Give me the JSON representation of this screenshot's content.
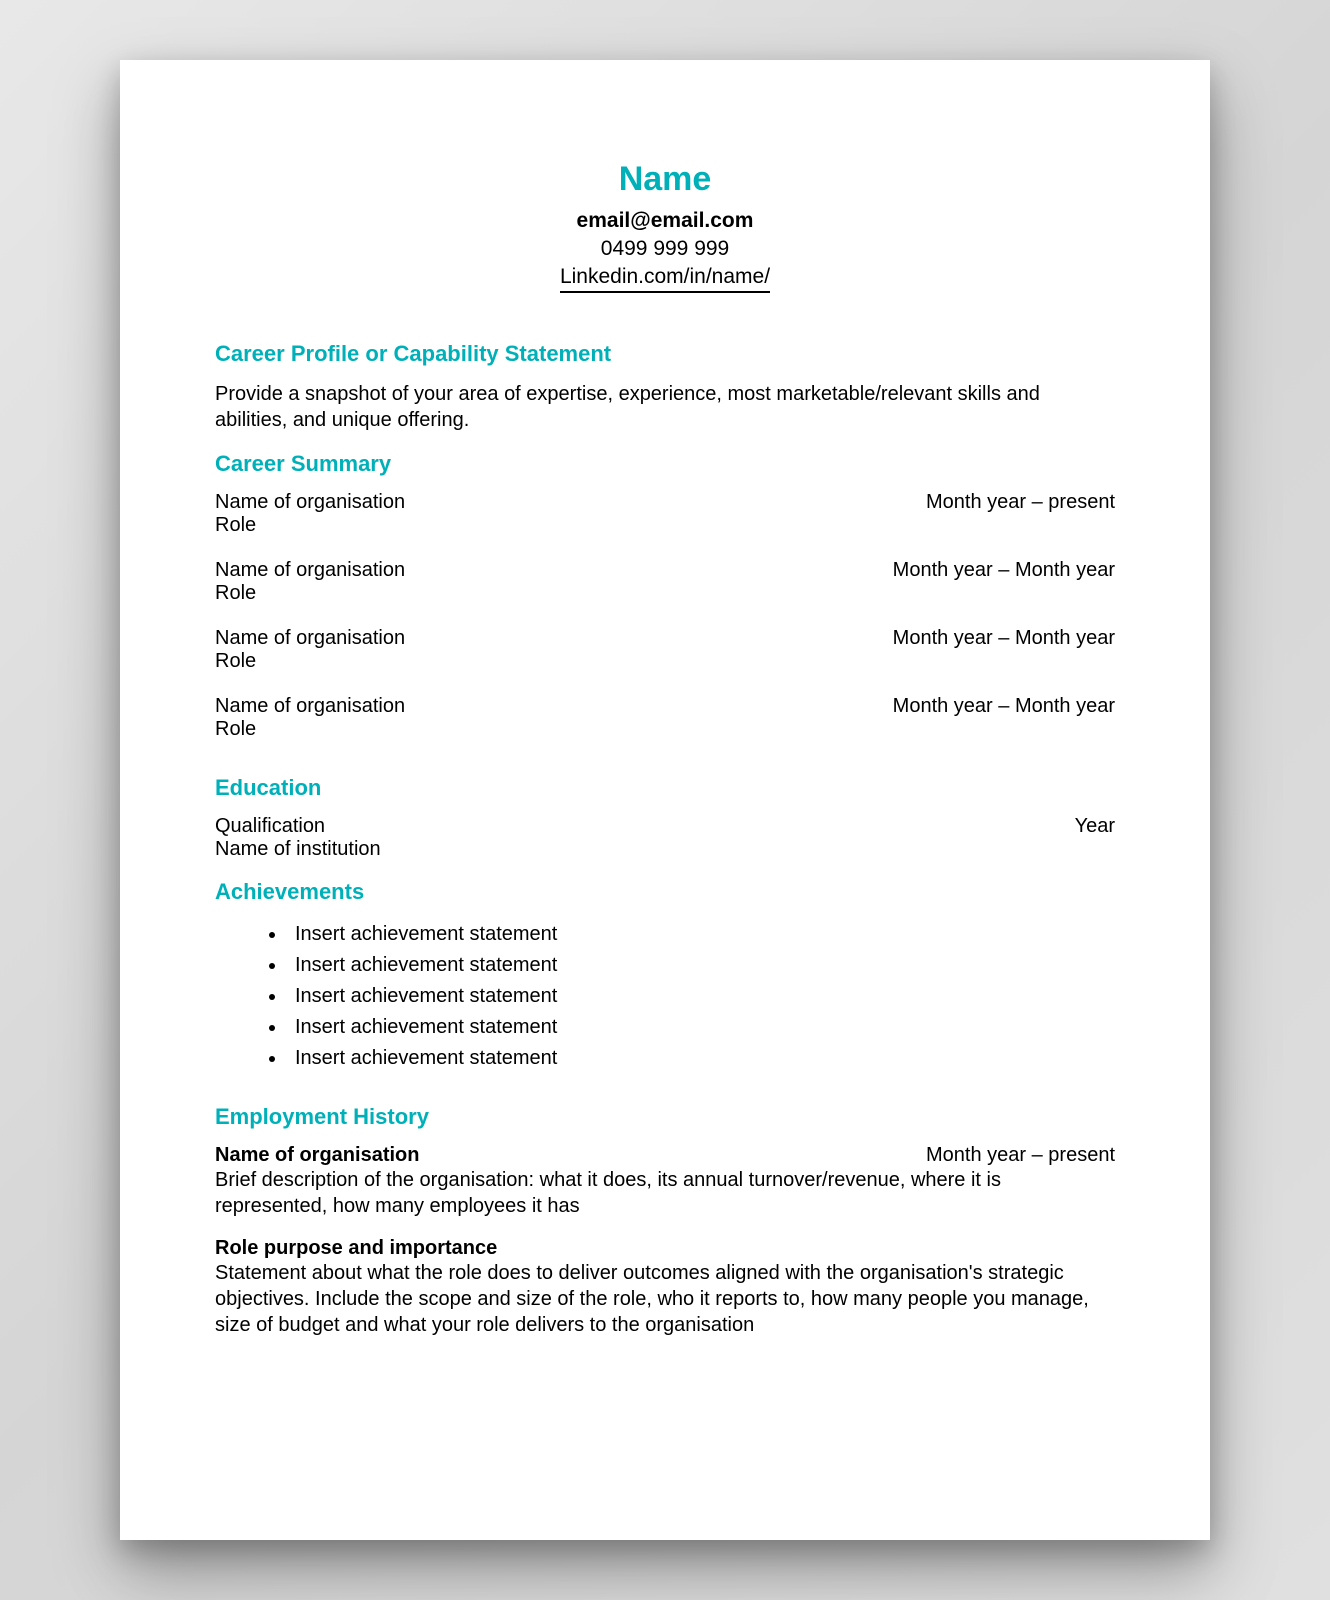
{
  "colors": {
    "accent": "#00b0b9"
  },
  "header": {
    "name": "Name",
    "email": "email@email.com",
    "phone": "0499 999 999",
    "linkedin": "Linkedin.com/in/name/"
  },
  "sections": {
    "career_profile": {
      "title": "Career Profile or Capability Statement",
      "body": "Provide a snapshot of your area of expertise, experience, most marketable/relevant skills and abilities, and unique offering."
    },
    "career_summary": {
      "title": "Career Summary",
      "items": [
        {
          "org": "Name of organisation",
          "date": "Month year – present",
          "role": "Role"
        },
        {
          "org": "Name of organisation",
          "date": "Month year – Month year",
          "role": "Role"
        },
        {
          "org": "Name of organisation",
          "date": "Month year – Month year",
          "role": "Role"
        },
        {
          "org": "Name of organisation",
          "date": "Month year – Month year",
          "role": "Role"
        }
      ]
    },
    "education": {
      "title": "Education",
      "qualification": "Qualification",
      "year": "Year",
      "institution": "Name of institution"
    },
    "achievements": {
      "title": "Achievements",
      "items": [
        "Insert achievement statement",
        "Insert achievement statement",
        "Insert achievement statement",
        "Insert achievement statement",
        "Insert achievement statement"
      ]
    },
    "employment": {
      "title": "Employment History",
      "org": "Name of organisation",
      "date": "Month year – present",
      "desc": "Brief description of the organisation: what it does, its annual turnover/revenue, where it is represented, how many employees it has",
      "role_heading": "Role purpose and importance",
      "role_desc": "Statement about what the role does to deliver outcomes aligned with the organisation's strategic objectives. Include the scope and size of the role, who it reports to, how many people you manage, size of budget and what your role delivers to the organisation"
    }
  }
}
